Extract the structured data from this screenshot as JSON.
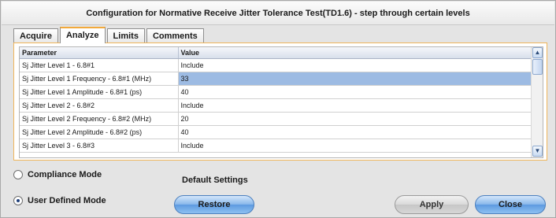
{
  "window": {
    "title": "Configuration for Normative Receive Jitter Tolerance Test(TD1.6) - step through certain levels"
  },
  "tabs": [
    {
      "label": "Acquire",
      "active": false
    },
    {
      "label": "Analyze",
      "active": true
    },
    {
      "label": "Limits",
      "active": false
    },
    {
      "label": "Comments",
      "active": false
    }
  ],
  "grid": {
    "columns": [
      "Parameter",
      "Value"
    ],
    "rows": [
      {
        "parameter": "Sj Jitter Level 1 - 6.8#1",
        "value": "Include"
      },
      {
        "parameter": "Sj Jitter Level 1 Frequency - 6.8#1 (MHz)",
        "value": "33"
      },
      {
        "parameter": "Sj Jitter Level 1 Amplitude - 6.8#1 (ps)",
        "value": "40"
      },
      {
        "parameter": "Sj Jitter Level 2 - 6.8#2",
        "value": "Include"
      },
      {
        "parameter": "Sj Jitter Level 2 Frequency - 6.8#2 (MHz)",
        "value": "20"
      },
      {
        "parameter": "Sj Jitter Level 2 Amplitude - 6.8#2 (ps)",
        "value": "40"
      },
      {
        "parameter": "Sj Jitter Level 3 - 6.8#3",
        "value": "Include"
      }
    ],
    "selected_row": 1,
    "scroll_up_glyph": "▲",
    "scroll_down_glyph": "▼"
  },
  "mode": {
    "compliance_label": "Compliance Mode",
    "user_defined_label": "User Defined Mode",
    "selected": "user_defined"
  },
  "default_settings": {
    "label": "Default Settings",
    "restore_label": "Restore"
  },
  "actions": {
    "apply_label": "Apply",
    "close_label": "Close"
  },
  "colors": {
    "active_tab_accent": "#f2a93b",
    "selection": "#9dbbe3",
    "primary_button": "#5d9ae0"
  }
}
